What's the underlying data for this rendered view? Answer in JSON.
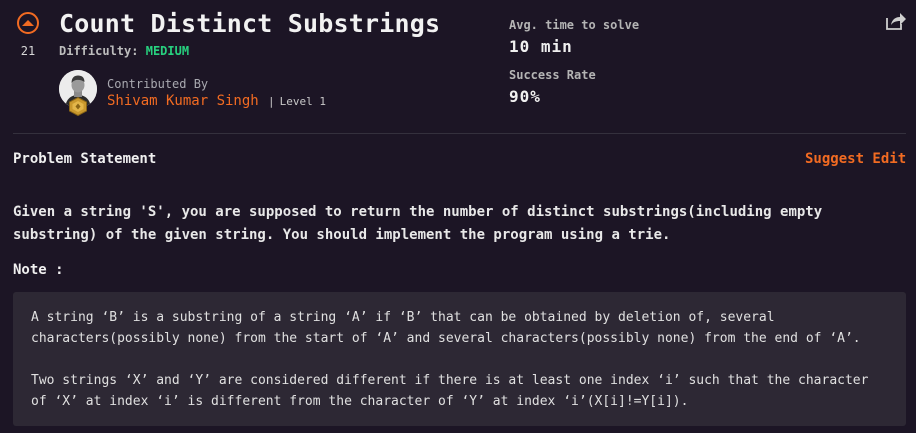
{
  "upvote": {
    "count": "21",
    "icon": "upvote-arrow-icon",
    "color": "#f26b22"
  },
  "problem": {
    "title": "Count Distinct Substrings",
    "difficulty_label": "Difficulty:",
    "difficulty": "MEDIUM",
    "difficulty_color": "#27d17f"
  },
  "contributor": {
    "label": "Contributed By",
    "name": "Shivam Kumar Singh",
    "level": "Level 1",
    "separator": "|"
  },
  "stats": {
    "avg_time_label": "Avg. time to solve",
    "avg_time_value": "10 min",
    "success_rate_label": "Success Rate",
    "success_rate_value": "90%"
  },
  "actions": {
    "share_icon": "share-icon",
    "suggest_edit": "Suggest Edit"
  },
  "statement": {
    "heading": "Problem Statement",
    "text": "Given a string 'S', you are supposed to return the number of distinct substrings(including empty substring) of the given string. You should implement the program using a trie.",
    "note_label": "Note :",
    "note_paragraphs": [
      "A string ‘B’ is a substring of a string ‘A’ if ‘B’ that can be obtained by deletion of, several characters(possibly none) from the start of ‘A’ and several characters(possibly none) from the end of ‘A’.",
      "Two strings ‘X’ and ‘Y’ are considered different if there is at least one index ‘i’  such that the character of ‘X’ at index ‘i’ is different from the character of ‘Y’ at index ‘i’(X[i]!=Y[i])."
    ]
  },
  "colors": {
    "background": "#1c1525",
    "accent": "#f26b22",
    "note_background": "#2d2834"
  }
}
